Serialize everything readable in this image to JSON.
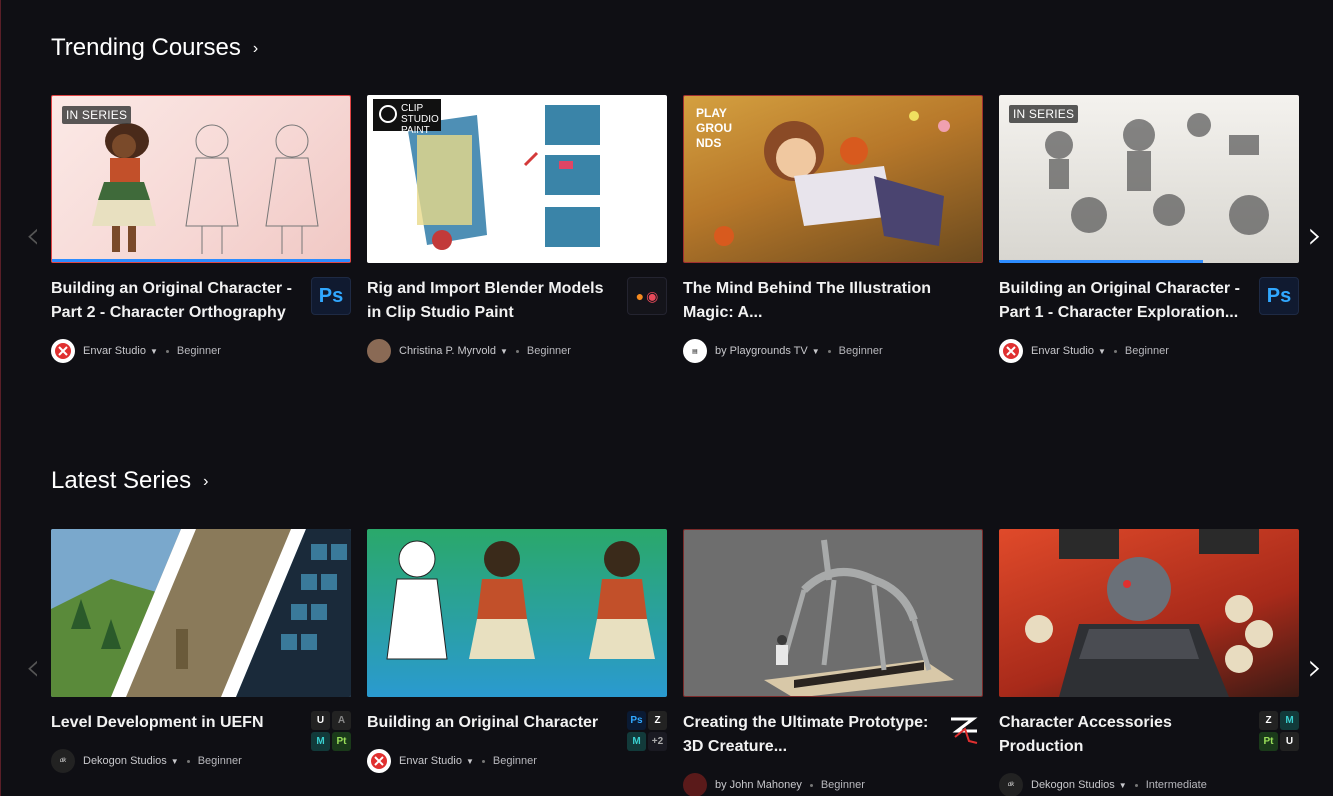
{
  "trending": {
    "title": "Trending Courses",
    "chevron": "›",
    "nav_prev": "‹",
    "nav_next": "›",
    "cards": [
      {
        "title": "Building an Original Character - Part 2 - Character Orthography",
        "badge": "IN SERIES",
        "author": "Envar Studio",
        "level": "Beginner",
        "software": [
          "Ps"
        ],
        "progress": 1.0
      },
      {
        "title": "Rig and Import Blender Models in Clip Studio Paint",
        "logo": "CLIP STUDIO PAINT",
        "author": "Christina P. Myrvold",
        "level": "Beginner",
        "software": [
          "blender-icon",
          "clip-studio-icon"
        ]
      },
      {
        "title": "The Mind Behind The Illustration Magic: A...",
        "logo": "PLAY GROU NDS",
        "author": "by Playgrounds TV",
        "level": "Beginner",
        "software": []
      },
      {
        "title": "Building an Original Character - Part 1 - Character Exploration...",
        "badge": "IN SERIES",
        "author": "Envar Studio",
        "level": "Beginner",
        "software": [
          "Ps"
        ],
        "progress": 0.68
      }
    ]
  },
  "latest": {
    "title": "Latest Series",
    "chevron": "›",
    "nav_prev": "‹",
    "nav_next": "›",
    "cards": [
      {
        "title": "Level Development in UEFN",
        "author": "Dekogon Studios",
        "level": "Beginner",
        "software": [
          "U",
          "A",
          "M",
          "Pt"
        ]
      },
      {
        "title": "Building an Original Character",
        "author": "Envar Studio",
        "level": "Beginner",
        "software": [
          "Ps",
          "Z",
          "M",
          "+2"
        ]
      },
      {
        "title": "Creating the Ultimate Prototype: 3D Creature...",
        "author": "by John Mahoney",
        "level": "Beginner",
        "software": [
          "zbrush-icon"
        ]
      },
      {
        "title": "Character Accessories Production",
        "author": "Dekogon Studios",
        "level": "Intermediate",
        "software": [
          "Z",
          "M",
          "Pt",
          "U"
        ]
      }
    ]
  },
  "colors": {
    "background": "#0f0f14",
    "progress": "#2d8cff",
    "photoshop": "#31a8ff",
    "envar_red": "#e03030"
  }
}
